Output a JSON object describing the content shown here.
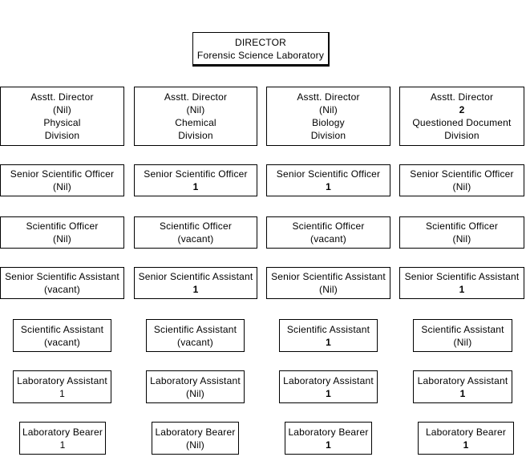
{
  "director": {
    "title": "DIRECTOR",
    "subtitle": "Forensic Science Laboratory"
  },
  "columns": [
    {
      "division": "Physical",
      "roles": [
        {
          "lines": [
            "Asstt. Director",
            "(Nil)",
            "Physical",
            "Division"
          ],
          "count": "(Nil)",
          "bold": false
        },
        {
          "title": "Senior Scientific Officer",
          "count": "(Nil)",
          "bold": false
        },
        {
          "title": "Scientific Officer",
          "count": "(Nil)",
          "bold": false
        },
        {
          "title": "Senior Scientific Assistant",
          "count": "(vacant)",
          "bold": false
        },
        {
          "title": "Scientific Assistant",
          "count": "(vacant)",
          "bold": false
        },
        {
          "title": "Laboratory Assistant",
          "count": "1",
          "bold": false
        },
        {
          "title": "Laboratory Bearer",
          "count": "1",
          "bold": false
        }
      ]
    },
    {
      "division": "Chemical",
      "roles": [
        {
          "lines": [
            "Asstt. Director",
            "(Nil)",
            "Chemical",
            "Division"
          ],
          "count": "(Nil)",
          "bold": false
        },
        {
          "title": "Senior Scientific Officer",
          "count": "1",
          "bold": true
        },
        {
          "title": "Scientific Officer",
          "count": "(vacant)",
          "bold": false
        },
        {
          "title": "Senior Scientific Assistant",
          "count": "1",
          "bold": true
        },
        {
          "title": "Scientific Assistant",
          "count": "(vacant)",
          "bold": false
        },
        {
          "title": "Laboratory Assistant",
          "count": "(Nil)",
          "bold": false
        },
        {
          "title": "Laboratory Bearer",
          "count": "(Nil)",
          "bold": false
        }
      ]
    },
    {
      "division": "Biology",
      "roles": [
        {
          "lines": [
            "Asstt. Director",
            "(Nil)",
            "Biology",
            "Division"
          ],
          "count": "(Nil)",
          "bold": false
        },
        {
          "title": "Senior Scientific Officer",
          "count": "1",
          "bold": true
        },
        {
          "title": "Scientific Officer",
          "count": "(vacant)",
          "bold": false
        },
        {
          "title": "Senior Scientific Assistant",
          "count": "(Nil)",
          "bold": false
        },
        {
          "title": "Scientific Assistant",
          "count": "1",
          "bold": true
        },
        {
          "title": "Laboratory Assistant",
          "count": "1",
          "bold": true
        },
        {
          "title": "Laboratory Bearer",
          "count": "1",
          "bold": true
        }
      ]
    },
    {
      "division": "Questioned Document",
      "roles": [
        {
          "lines": [
            "Asstt. Director",
            "2",
            "Questioned Document",
            "Division"
          ],
          "count": "2",
          "bold": true
        },
        {
          "title": "Senior Scientific Officer",
          "count": "(Nil)",
          "bold": false
        },
        {
          "title": "Scientific Officer",
          "count": "(Nil)",
          "bold": false
        },
        {
          "title": "Senior Scientific Assistant",
          "count": "1",
          "bold": true
        },
        {
          "title": "Scientific Assistant",
          "count": "(Nil)",
          "bold": false
        },
        {
          "title": "Laboratory Assistant",
          "count": "1",
          "bold": true
        },
        {
          "title": "Laboratory Bearer",
          "count": "1",
          "bold": true
        }
      ]
    }
  ]
}
